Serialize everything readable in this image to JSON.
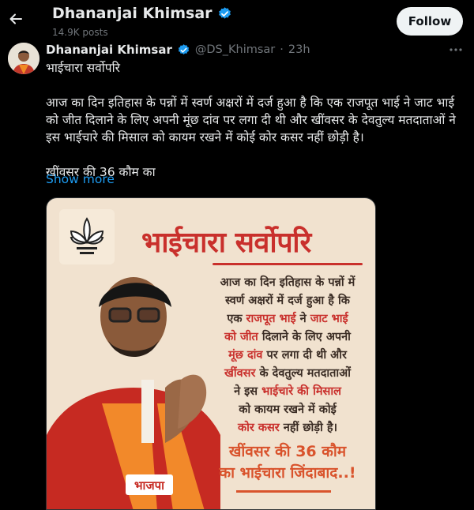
{
  "header": {
    "name": "Dhananjai Khimsar",
    "post_count": "14.9K posts",
    "follow_label": "Follow"
  },
  "tweet": {
    "author_name": "Dhananjai Khimsar",
    "handle": "@DS_Khimsar",
    "separator": "·",
    "time": "23h",
    "lines": {
      "title": "भाईचारा सर्वोपरि",
      "l1": "आज का दिन इतिहास के पन्नों में स्वर्ण अक्षरों में दर्ज हुआ है कि एक राजपूत भाई ने जाट भाई",
      "l2": "को जीत दिलाने के लिए अपनी मूंछ दांव पर लगा दी थी और खींवसर के देवतुल्य मतदाताओं ने",
      "l3": "इस भाईचारे की मिसाल को कायम रखने में कोई कोर कसर नहीं छोड़ी है।",
      "l4": "खींवसर की 36 कौम का"
    },
    "show_more": "Show more"
  },
  "media": {
    "title": "भाईचारा सर्वोपरि",
    "body": {
      "b1": "आज का दिन इतिहास के पन्नों में",
      "b2": "स्वर्ण अक्षरों में दर्ज हुआ है कि",
      "b3a": "एक ",
      "b3b": "राजपूत भाई",
      "b3c": " ने ",
      "b3d": "जाट भाई",
      "b4a": "को जीत",
      "b4b": " दिलाने के लिए अपनी",
      "b5a": "मूंछ दांव",
      "b5b": " पर लगा दी थी और",
      "b6a": "खींवसर",
      "b6b": " के देवतुल्य मतदाताओं",
      "b7a": "ने इस ",
      "b7b": "भाईचारे की मिसाल",
      "b8": "को कायम रखने में कोई",
      "b9a": "कोर कसर",
      "b9b": " नहीं छोड़ी है।"
    },
    "slogan": {
      "s1": "खींवसर की 36 कौम",
      "s2": "का भाईचारा जिंदाबाद..!"
    },
    "badge_text": "भाजपा"
  },
  "colors": {
    "accent": "#1d9bf0",
    "verified": "#1d9bf0",
    "poster_red": "#c9302c",
    "poster_bg": "#f1e2cf"
  },
  "icons": {
    "back": "arrow-left-icon",
    "verified": "verified-badge-icon",
    "more": "more-horizontal-icon",
    "logo": "lotus-logo-icon"
  }
}
